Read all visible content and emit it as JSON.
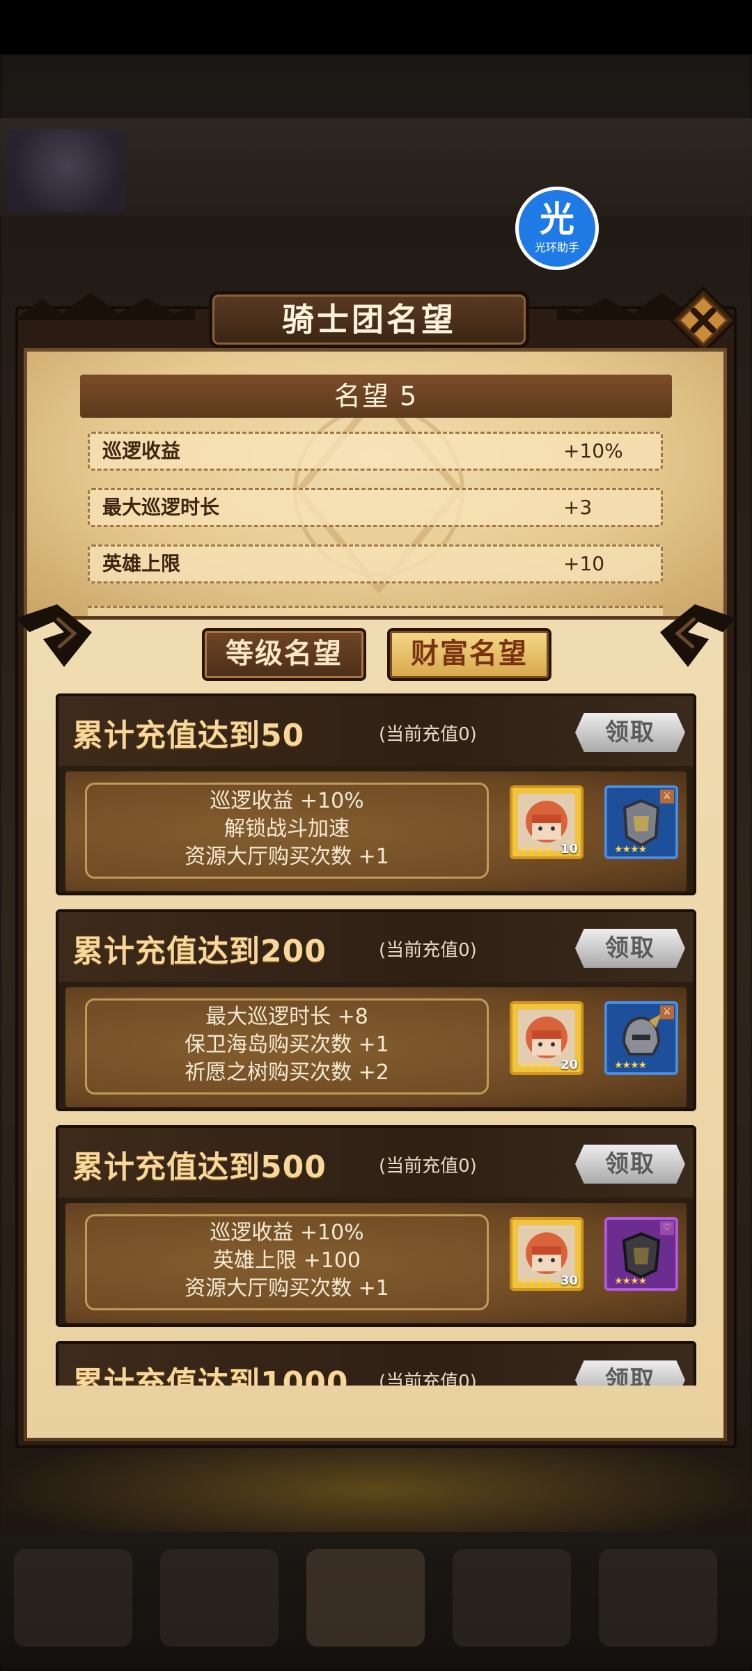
{
  "helper": {
    "glyph": "光",
    "label": "光环助手"
  },
  "dialog": {
    "title": "骑士团名望"
  },
  "reputation": {
    "header": "名望 5",
    "rows": [
      {
        "label": "巡逻收益",
        "value": "+10%"
      },
      {
        "label": "最大巡逻时长",
        "value": "+3"
      },
      {
        "label": "英雄上限",
        "value": "+10"
      }
    ]
  },
  "tabs": [
    {
      "label": "等级名望",
      "active": false
    },
    {
      "label": "财富名望",
      "active": true
    }
  ],
  "milestones": [
    {
      "title": "累计充值达到50",
      "current": "(当前充值0)",
      "button": "领取",
      "perks": [
        "巡逻收益 +10%",
        "解锁战斗加速",
        "资源大厅购买次数 +1"
      ],
      "rewards": [
        {
          "kind": "hero",
          "count": "10",
          "stars": "★★★★"
        },
        {
          "kind": "equipment-blue",
          "stars": "★★★★"
        }
      ]
    },
    {
      "title": "累计充值达到200",
      "current": "(当前充值0)",
      "button": "领取",
      "perks": [
        "最大巡逻时长 +8",
        "保卫海岛购买次数 +1",
        "祈愿之树购买次数 +2"
      ],
      "rewards": [
        {
          "kind": "hero",
          "count": "20",
          "stars": "★★★★"
        },
        {
          "kind": "equipment-blue",
          "stars": "★★★★"
        }
      ]
    },
    {
      "title": "累计充值达到500",
      "current": "(当前充值0)",
      "button": "领取",
      "perks": [
        "巡逻收益 +10%",
        "英雄上限 +100",
        "资源大厅购买次数 +1"
      ],
      "rewards": [
        {
          "kind": "hero",
          "count": "30",
          "stars": "★★★★"
        },
        {
          "kind": "equipment-purple",
          "stars": "★★★★"
        }
      ]
    },
    {
      "title": "累计充值达到1000",
      "current": "(当前充值0)",
      "button": "领取"
    }
  ],
  "colors": {
    "accent_gold": "#f7d79a",
    "panel_parchment": "#f0dcb2",
    "card_dark": "#2a1d12",
    "helper_blue": "#1f7ae6"
  }
}
